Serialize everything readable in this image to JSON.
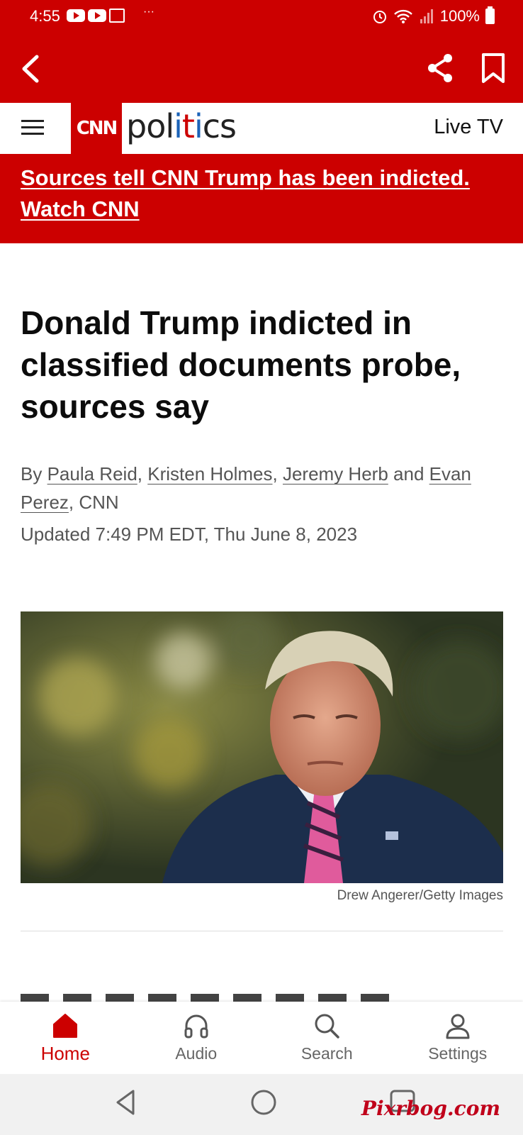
{
  "status_bar": {
    "time": "4:55",
    "battery": "100%",
    "dots": "···"
  },
  "header": {
    "back": "back",
    "share": "share",
    "bookmark": "bookmark"
  },
  "nav": {
    "brand": "CNN",
    "section_prefix": "pol",
    "section_i1": "i",
    "section_t": "t",
    "section_i2": "i",
    "section_suffix": "cs",
    "live_tv": "Live TV"
  },
  "alert": {
    "line1": "Sources tell CNN Trump has been indicted.",
    "line2": "Watch CNN"
  },
  "article": {
    "headline": "Donald Trump indicted in classified documents probe, sources say",
    "by": "By ",
    "authors": [
      "Paula Reid",
      "Kristen Holmes",
      "Jeremy Herb",
      "Evan Perez"
    ],
    "sep": ", ",
    "and": " and ",
    "outlet": ", CNN",
    "updated": "Updated 7:49 PM EDT, Thu June 8, 2023",
    "photo_credit": "Drew Angerer/Getty Images"
  },
  "tabs": [
    {
      "label": "Home",
      "icon": "home-icon",
      "active": true
    },
    {
      "label": "Audio",
      "icon": "headphones-icon",
      "active": false
    },
    {
      "label": "Search",
      "icon": "search-icon",
      "active": false
    },
    {
      "label": "Settings",
      "icon": "person-icon",
      "active": false
    }
  ],
  "watermark": "Pixrbog.com",
  "colors": {
    "brand_red": "#cc0000",
    "text": "#111111",
    "muted": "#555555"
  }
}
